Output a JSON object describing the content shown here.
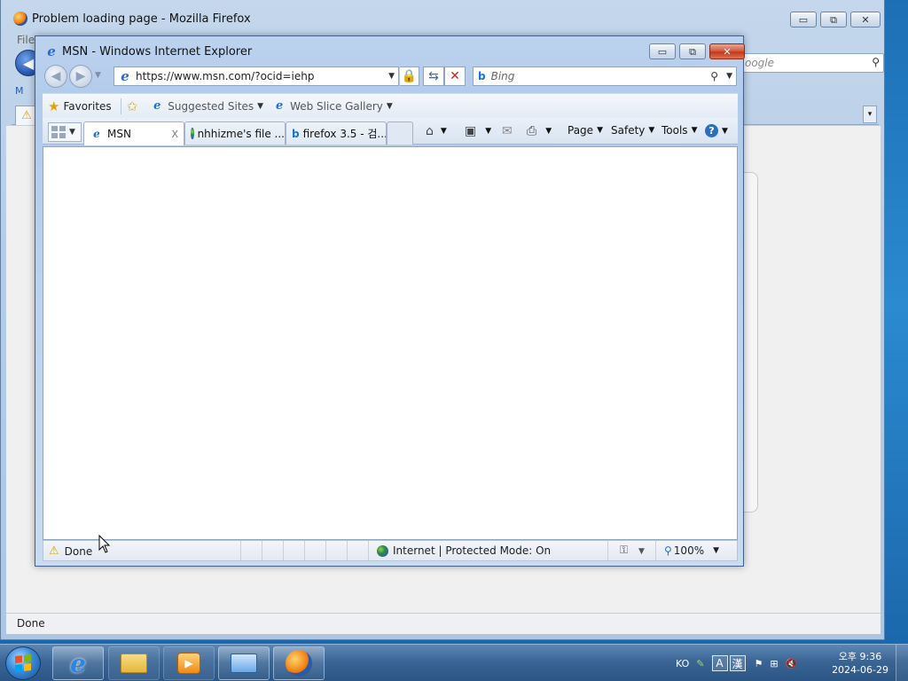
{
  "firefox": {
    "title": "Problem loading page - Mozilla Firefox",
    "menu_partial": "File",
    "search_partial": "oogle",
    "bookmark_partial": "M",
    "status": "Done",
    "caption": {
      "minimize": "▭",
      "restore": "⧉",
      "close": "✕"
    }
  },
  "ie": {
    "title": "MSN - Windows Internet Explorer",
    "caption": {
      "minimize": "▭",
      "restore": "⧉",
      "close": "✕"
    },
    "address": "https://www.msn.com/?ocid=iehp",
    "search_placeholder": "Bing",
    "favorites": {
      "favorites_label": "Favorites",
      "suggested_sites": "Suggested Sites",
      "web_slice_gallery": "Web Slice Gallery"
    },
    "tabs": [
      {
        "label": "MSN",
        "close": "X"
      },
      {
        "label": "nhhizme's file ..."
      },
      {
        "label": "firefox 3.5 - 검..."
      }
    ],
    "commands": {
      "page": "Page",
      "safety": "Safety",
      "tools": "Tools",
      "help": "?"
    },
    "status": {
      "done": "Done",
      "zone": "Internet | Protected Mode: On",
      "zoom": "100%"
    }
  },
  "taskbar": {
    "language": "KO",
    "ime_a": "A",
    "ime_han": "漢",
    "time": "오후 9:36",
    "date": "2024-06-29"
  }
}
